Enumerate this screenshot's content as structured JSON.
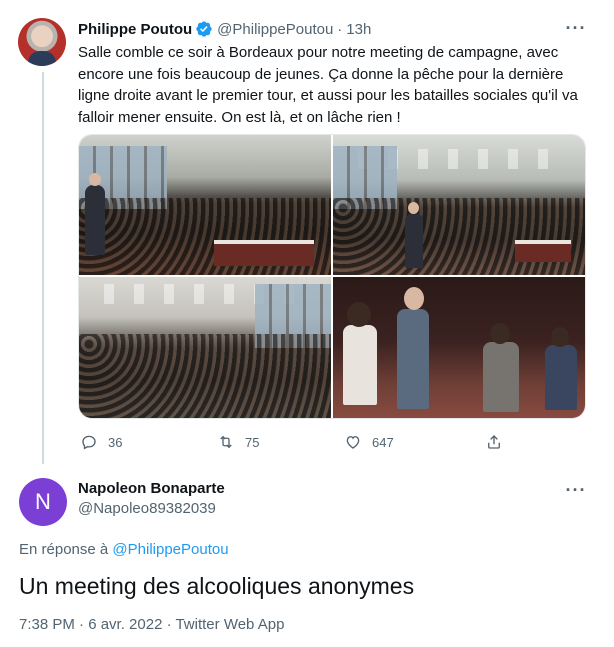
{
  "tweet1": {
    "name": "Philippe Poutou",
    "handle": "@PhilippePoutou",
    "separator": "·",
    "time": "13h",
    "text": "Salle comble ce soir à Bordeaux pour notre meeting de campagne, avec encore une fois beaucoup de jeunes. Ça donne la pêche pour la dernière ligne droite avant le premier tour, et aussi pour les batailles sociales qu'il va falloir mener ensuite. On est là, et on lâche rien !",
    "more": "···",
    "actions": {
      "replies": "36",
      "retweets": "75",
      "likes": "647"
    }
  },
  "tweet2": {
    "avatar_letter": "N",
    "name": "Napoleon Bonaparte",
    "handle": "@Napoleo89382039",
    "more": "···",
    "reply_prefix": "En réponse à",
    "reply_mention": "@PhilippePoutou",
    "text": "Un meeting des alcooliques anonymes",
    "meta": "7:38 PM · 6 avr. 2022 · Twitter Web App"
  },
  "colors": {
    "accent": "#1d9bf0",
    "muted": "#536471",
    "text": "#0f1419",
    "avatar_nb": "#7b3fd6"
  },
  "icons": [
    "verified-badge-icon",
    "more-icon",
    "reply-icon",
    "retweet-icon",
    "like-icon",
    "share-icon"
  ]
}
